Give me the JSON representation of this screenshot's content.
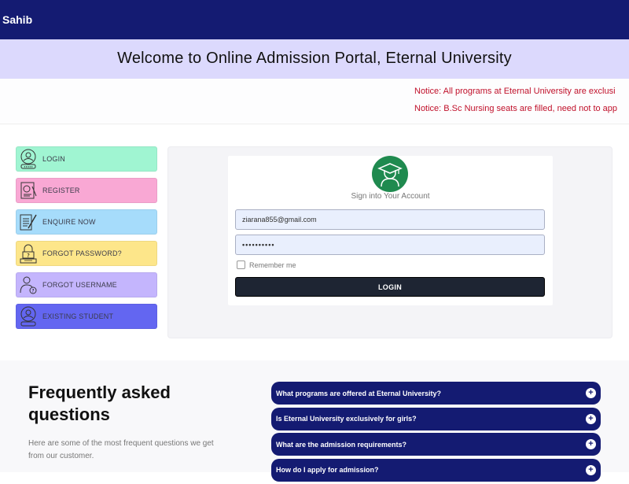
{
  "header": {
    "brand": "Sahib"
  },
  "banner": {
    "title": "Welcome to Online Admission Portal, Eternal University"
  },
  "notices": [
    "Notice: All programs at Eternal University are exclusi",
    "Notice: B.Sc Nursing seats are filled, need not to app"
  ],
  "menu": {
    "items": [
      {
        "label": "LOGIN",
        "icon": "user-icon",
        "color": "#a0f5d2"
      },
      {
        "label": "REGISTER",
        "icon": "register-form-icon",
        "color": "#f9a8d4"
      },
      {
        "label": "ENQUIRE NOW",
        "icon": "document-pen-icon",
        "color": "#a6dcfb"
      },
      {
        "label": "FORGOT PASSWORD?",
        "icon": "lock-question-icon",
        "color": "#fde68a"
      },
      {
        "label": "FORGOT USERNAME",
        "icon": "user-question-icon",
        "color": "#c4b5fd"
      },
      {
        "label": "EXISTING STUDENT",
        "icon": "user-icon",
        "color": "#6366f1"
      }
    ]
  },
  "login": {
    "heading": "Sign into Your Account",
    "email_value": "ziarana855@gmail.com",
    "password_value": "••••••••••",
    "remember_label": "Remember me",
    "button_label": "LOGIN",
    "avatar_color": "#1f8a4f"
  },
  "faq": {
    "title": "Frequently asked questions",
    "subtitle": "Here are some of the most frequent questions we get from our customer.",
    "items": [
      "What programs are offered at Eternal University?",
      "Is Eternal University exclusively for girls?",
      "What are the admission requirements?",
      "How do I apply for admission?"
    ],
    "accent": "#141b72"
  },
  "colors": {
    "topbar": "#141b72",
    "banner": "#dcd9fd",
    "notice": "#c0102a"
  }
}
